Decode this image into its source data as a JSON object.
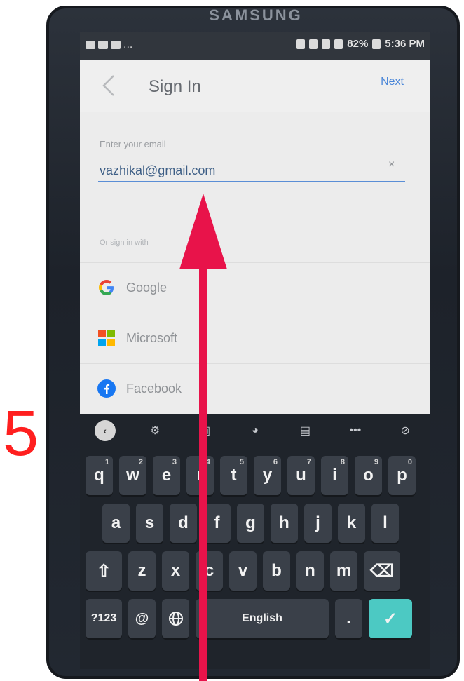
{
  "step_number": "5",
  "device": {
    "brand": "SAMSUNG"
  },
  "status_bar": {
    "more": "...",
    "right_text": "82%",
    "time": "5:36 PM"
  },
  "app_bar": {
    "title": "Sign In",
    "next_label": "Next"
  },
  "form": {
    "email_label": "Enter your email",
    "email_value": "vazhikal@gmail.com",
    "clear_symbol": "×",
    "or_label": "Or sign in with"
  },
  "providers": [
    {
      "label": "Google",
      "icon": "google-icon"
    },
    {
      "label": "Microsoft",
      "icon": "microsoft-icon"
    },
    {
      "label": "Facebook",
      "icon": "facebook-icon"
    }
  ],
  "keyboard": {
    "toolbar": [
      "back-icon",
      "gear-icon",
      "sticker-icon",
      "palette-icon",
      "clipboard-icon",
      "more-icon",
      "mic-off-icon"
    ],
    "toolbar_more": "•••",
    "row1": [
      {
        "key": "q",
        "sup": "1"
      },
      {
        "key": "w",
        "sup": "2"
      },
      {
        "key": "e",
        "sup": "3"
      },
      {
        "key": "r",
        "sup": "4"
      },
      {
        "key": "t",
        "sup": "5"
      },
      {
        "key": "y",
        "sup": "6"
      },
      {
        "key": "u",
        "sup": "7"
      },
      {
        "key": "i",
        "sup": "8"
      },
      {
        "key": "o",
        "sup": "9"
      },
      {
        "key": "p",
        "sup": "0"
      }
    ],
    "row2": [
      "a",
      "s",
      "d",
      "f",
      "g",
      "h",
      "j",
      "k",
      "l"
    ],
    "row3": [
      "z",
      "x",
      "c",
      "v",
      "b",
      "n",
      "m"
    ],
    "symbols_label": "?123",
    "at_label": "@",
    "space_label": "English",
    "period_label": ".",
    "enter_symbol": "✓"
  },
  "colors": {
    "step_number": "#ff1f1f",
    "arrow": "#e8134a",
    "link": "#4a86d8",
    "enter_key": "#4cc9c3"
  }
}
